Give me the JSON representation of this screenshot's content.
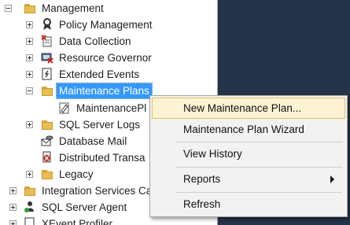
{
  "tree": {
    "items": [
      {
        "label": "Management"
      },
      {
        "label": "Policy Management"
      },
      {
        "label": "Data Collection"
      },
      {
        "label": "Resource Governor"
      },
      {
        "label": "Extended Events"
      },
      {
        "label": "Maintenance Plans"
      },
      {
        "label": "MaintenancePl"
      },
      {
        "label": "SQL Server Logs"
      },
      {
        "label": "Database Mail"
      },
      {
        "label": "Distributed Transa"
      },
      {
        "label": "Legacy"
      },
      {
        "label": "Integration Services Ca"
      },
      {
        "label": "SQL Server Agent"
      },
      {
        "label": "XEvent Profiler"
      }
    ]
  },
  "context_menu": {
    "items": [
      {
        "label": "New Maintenance Plan..."
      },
      {
        "label": "Maintenance Plan Wizard"
      },
      {
        "label": "View History"
      },
      {
        "label": "Reports"
      },
      {
        "label": "Refresh"
      }
    ]
  },
  "colors": {
    "selection": "#3399ff",
    "menu_highlight": "#fcf3d4",
    "side_panel": "#253349",
    "folder": "#e8bd52"
  },
  "icons": [
    "expand-collapse-icon",
    "folder-icon",
    "policy-icon",
    "data-collection-icon",
    "resource-governor-icon",
    "extended-events-icon",
    "maintenance-plan-icon",
    "database-mail-icon",
    "distributed-transaction-icon",
    "sql-agent-icon",
    "submenu-arrow-icon"
  ]
}
